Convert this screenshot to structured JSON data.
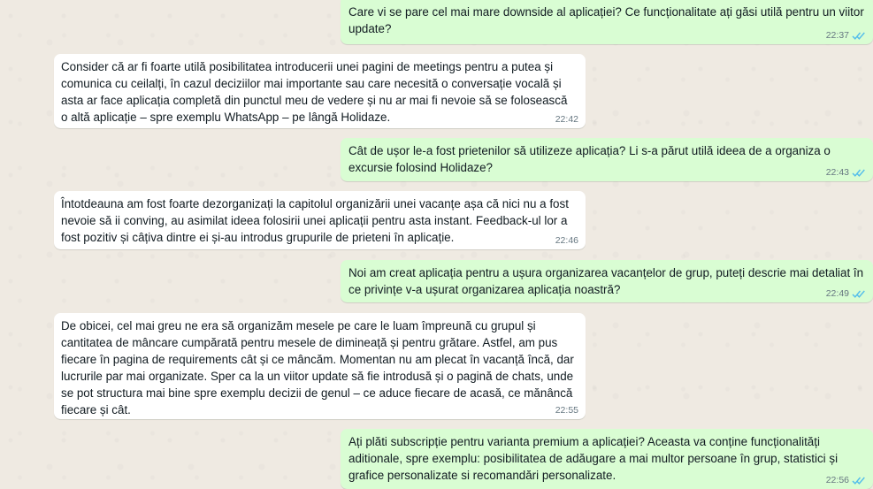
{
  "messages": [
    {
      "direction": "outgoing",
      "text": "Care vi se pare cel mai mare downside al aplicației? Ce funcționalitate ați găsi utilă pentru un viitor update?",
      "time": "22:37",
      "status": "read"
    },
    {
      "direction": "incoming",
      "text": "Consider că ar fi foarte utilă posibilitatea introducerii unei pagini de meetings pentru a putea și comunica cu ceilalți, în cazul deciziilor mai importante sau care necesită o conversație vocală și asta ar face aplicația completă din punctul meu de vedere și nu ar mai fi nevoie să se folosească o altă aplicație – spre exemplu WhatsApp – pe lângă Holidaze.",
      "time": "22:42"
    },
    {
      "direction": "outgoing",
      "text": "Cât de ușor le-a fost prietenilor să utilizeze aplicația? Li s-a părut utilă ideea de a organiza o excursie folosind Holidaze?",
      "time": "22:43",
      "status": "read"
    },
    {
      "direction": "incoming",
      "text": "Întotdeauna am fost foarte dezorganizați la capitolul organizării unei vacanțe așa că nici nu a fost nevoie să ii conving, au asimilat ideea folosirii unei aplicații pentru asta instant. Feedback-ul lor a fost pozitiv și câțiva dintre ei și-au introdus grupurile de prieteni în aplicație.",
      "time": "22:46"
    },
    {
      "direction": "outgoing",
      "text": "Noi am creat aplicația pentru a ușura organizarea vacanțelor de grup, puteți descrie mai detaliat în ce privințe v-a ușurat organizarea aplicația noastră?",
      "time": "22:49",
      "status": "read"
    },
    {
      "direction": "incoming",
      "text": "De obicei, cel mai greu ne era să organizăm mesele pe care le luam împreună cu grupul și cantitatea de mâncare cumpărată pentru mesele de dimineață și pentru grătare. Astfel, am pus fiecare în pagina de requirements cât și ce mâncăm. Momentan nu am plecat în vacanță încă, dar lucrurile par mai organizate. Sper ca la un viitor update să fie introdusă și o pagină de chats, unde se pot structura mai bine spre exemplu decizii de genul – ce aduce fiecare de acasă, ce mănâncă fiecare și cât.",
      "time": "22:55"
    },
    {
      "direction": "outgoing",
      "text": "Ați plăti subscripție pentru varianta premium a aplicației? Aceasta va conține funcționalități aditionale, spre exemplu: posibilitatea de adăugare a mai multor persoane în grup, statistici și grafice personalizate si recomandări personalizate.",
      "time": "22:56",
      "status": "read"
    }
  ],
  "colors": {
    "background": "#efeae2",
    "outgoing_bubble": "#d9fdd3",
    "incoming_bubble": "#ffffff",
    "read_ticks": "#53bdeb",
    "meta_text": "#667781"
  },
  "icons": {
    "read_status": "double-check-icon"
  }
}
